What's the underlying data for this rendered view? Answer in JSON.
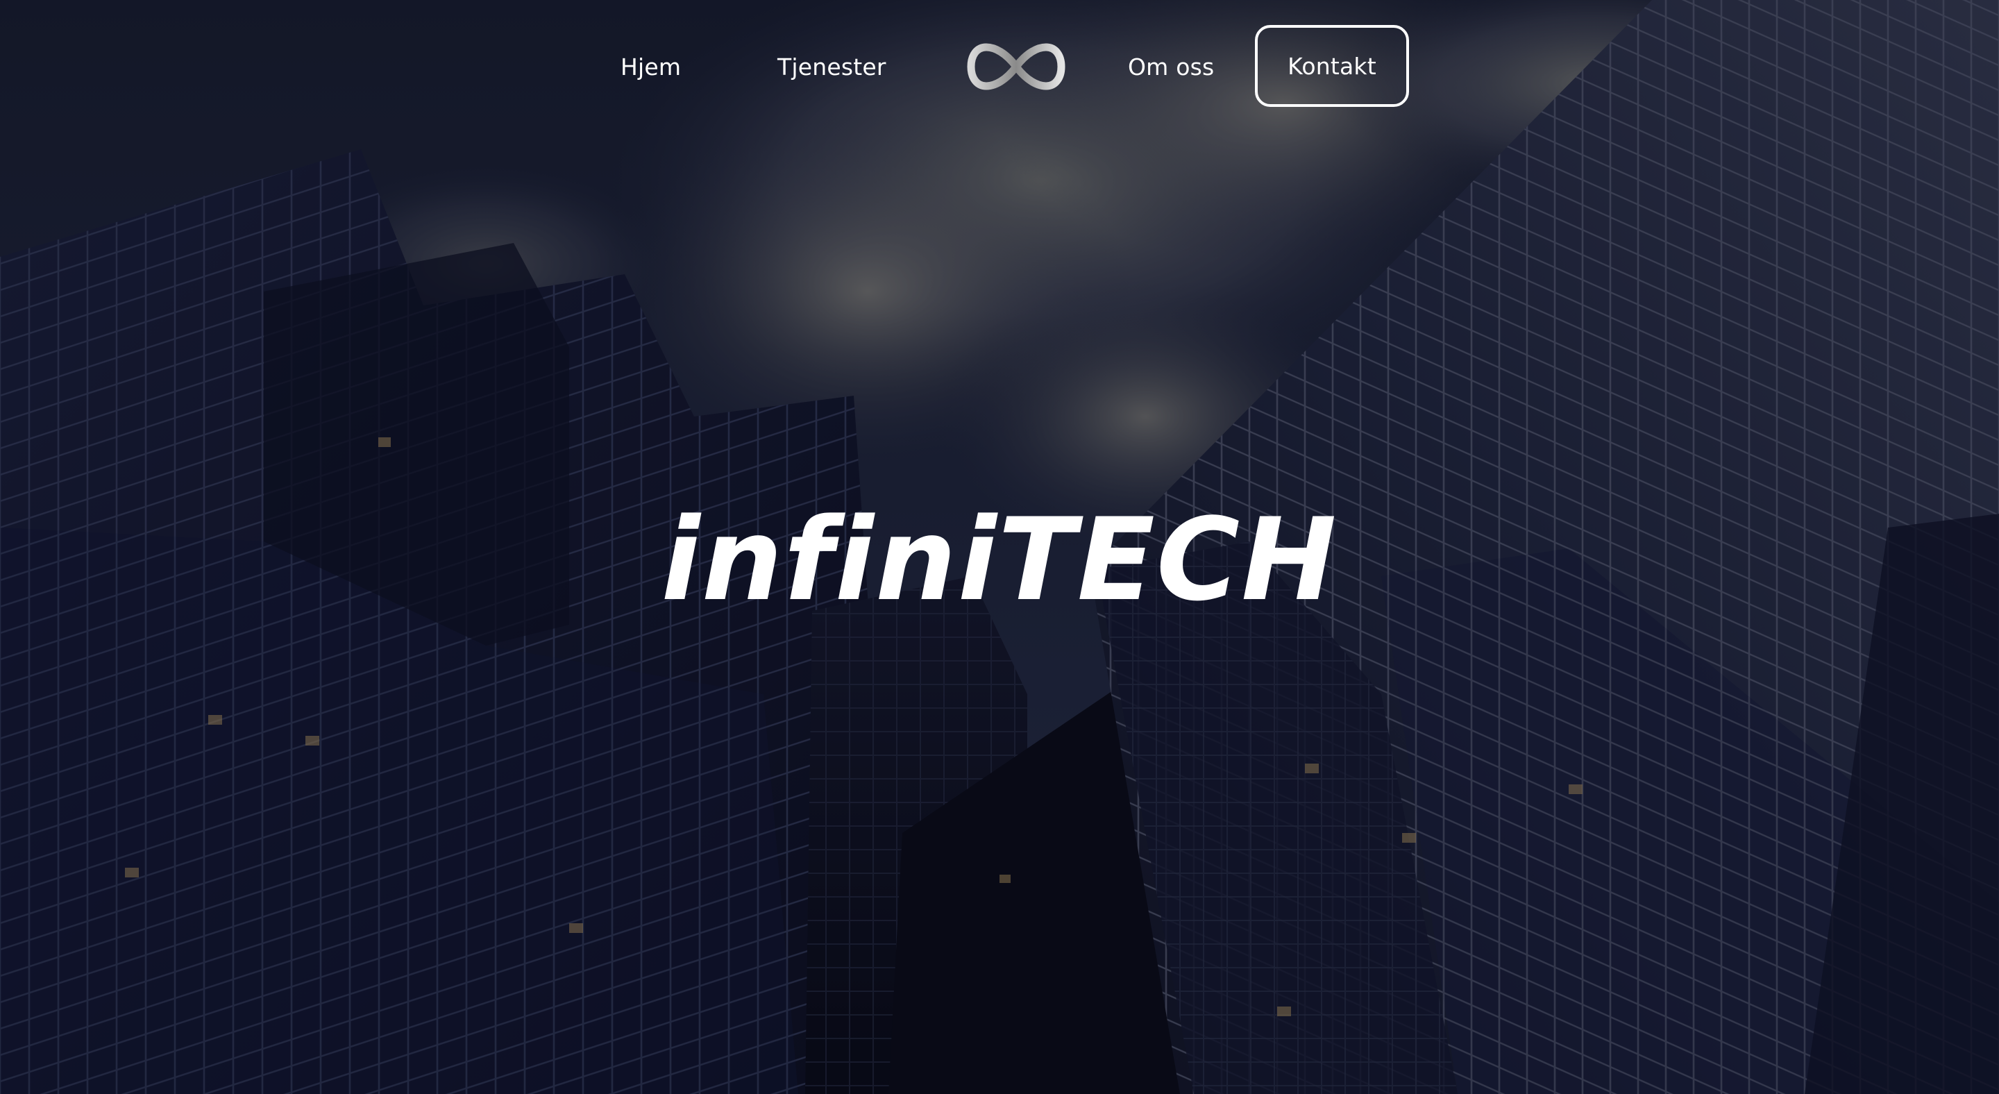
{
  "nav": {
    "home_label": "Hjem",
    "services_label": "Tjenester",
    "about_label": "Om oss",
    "contact_label": "Kontakt",
    "logo_icon": "infinity-icon"
  },
  "hero": {
    "title": "infiniTECH",
    "background": "skyscrapers-photo"
  },
  "colors": {
    "text": "#ffffff",
    "overlay": "#080914",
    "sky": "#1c2137"
  }
}
